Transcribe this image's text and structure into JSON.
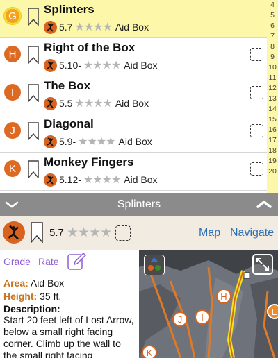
{
  "routes": [
    {
      "letter": "G",
      "name": "Splinters",
      "grade": "5.7",
      "stars": "★★★★",
      "area": "Aid Box",
      "selected": true
    },
    {
      "letter": "H",
      "name": "Right of the Box",
      "grade": "5.10-",
      "stars": "★★★★",
      "area": "Aid Box"
    },
    {
      "letter": "I",
      "name": "The Box",
      "grade": "5.5",
      "stars": "★★★★",
      "area": "Aid Box"
    },
    {
      "letter": "J",
      "name": "Diagonal",
      "grade": "5.9-",
      "stars": "★★★★",
      "area": "Aid Box"
    },
    {
      "letter": "K",
      "name": "Monkey Fingers",
      "grade": "5.12-",
      "stars": "★★★★",
      "area": "Aid Box"
    }
  ],
  "index_numbers": [
    "4",
    "5",
    "6",
    "7",
    "8",
    "9",
    "10",
    "11",
    "12",
    "13",
    "14",
    "15",
    "16",
    "17",
    "18",
    "19",
    "20"
  ],
  "detail_bar": {
    "title": "Splinters"
  },
  "detail": {
    "grade": "5.7",
    "stars": "★★★★",
    "map_link": "Map",
    "navigate_link": "Navigate",
    "grade_button": "Grade",
    "rate_button": "Rate",
    "area_label": "Area:",
    "area_value": "Aid Box",
    "height_label": "Height:",
    "height_value": "35 ft.",
    "description_label": "Description:",
    "description_text": "Start 20 feet left of Lost Arrow, below a small right facing corner. Climb up the wall to the small right facing"
  },
  "photo_pins": [
    "H",
    "J",
    "I",
    "K",
    "E"
  ],
  "colors": {
    "accent_orange": "#d8621f",
    "highlight_yellow": "#fcf7a9",
    "link_blue": "#2d6fb3",
    "purple": "#8e5fd0",
    "label_orange": "#c8741e"
  }
}
